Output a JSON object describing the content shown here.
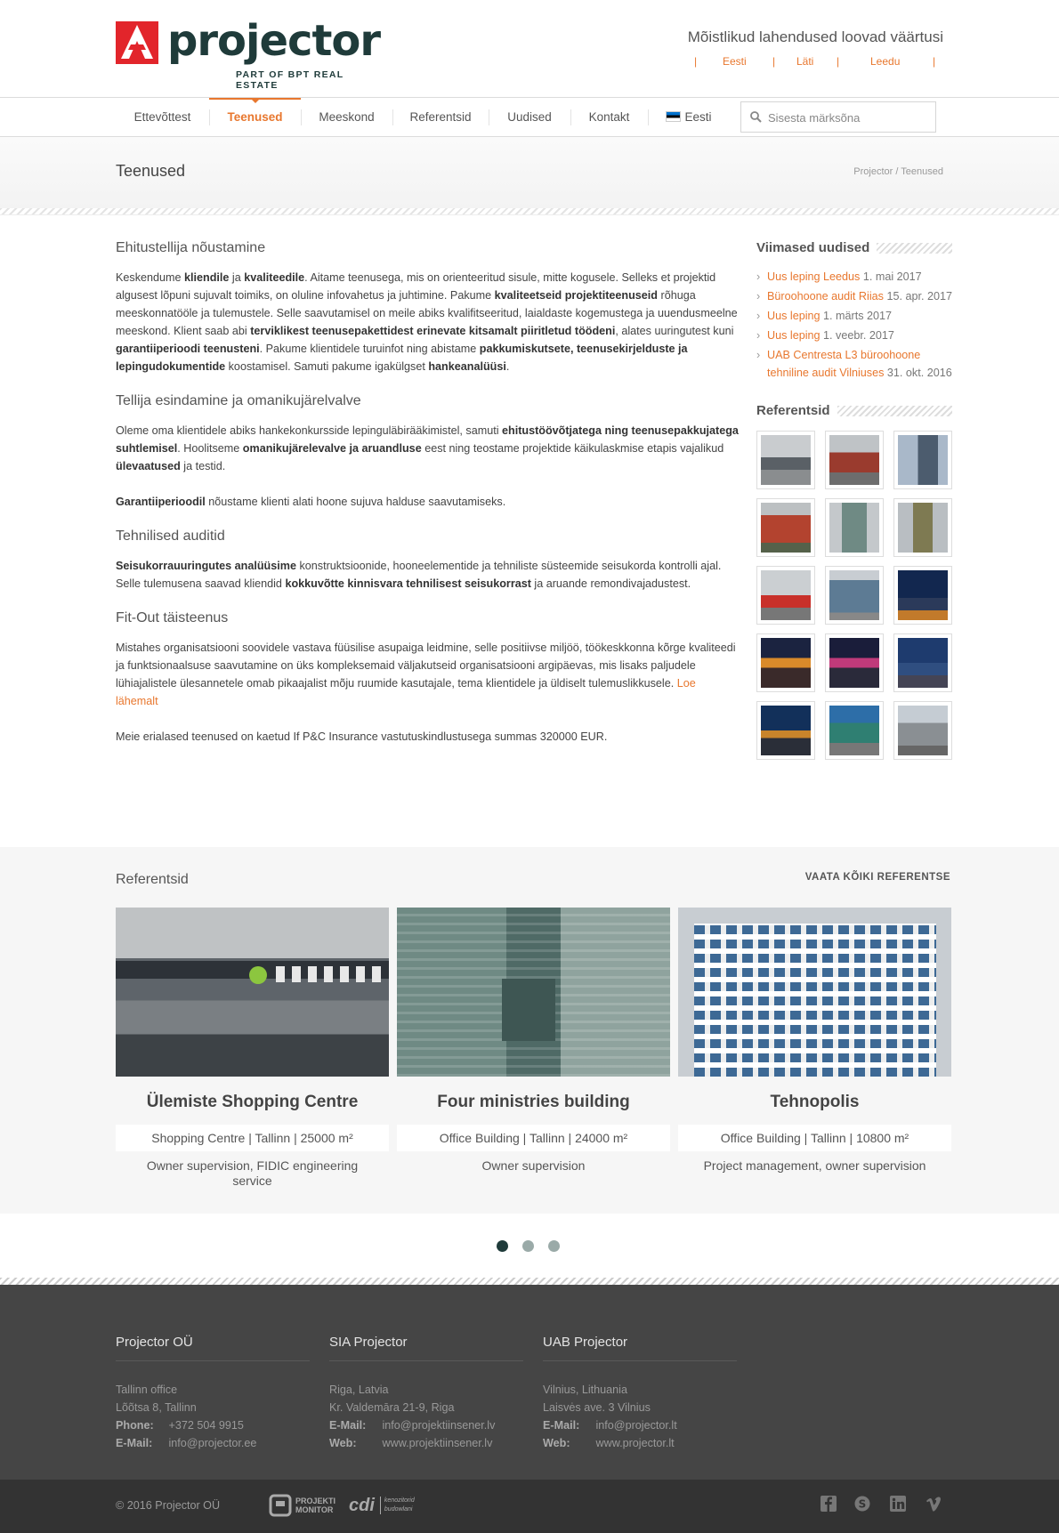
{
  "header": {
    "logo_text": "projector",
    "logo_sub": "PART OF BPT REAL ESTATE",
    "tagline": "Mõistlikud lahendused loovad väärtusi",
    "languages": [
      "Eesti",
      "Läti",
      "Leedu"
    ]
  },
  "nav": {
    "items": [
      "Ettevõttest",
      "Teenused",
      "Meeskond",
      "Referentsid",
      "Uudised",
      "Kontakt"
    ],
    "active": "Teenused",
    "lang_label": "Eesti",
    "search_placeholder": "Sisesta märksõna"
  },
  "titlebar": {
    "title": "Teenused",
    "breadcrumb": "Projector / Teenused"
  },
  "main": {
    "sec1_title": "Ehitustellija nõustamine",
    "sec2_title": "Tellija esindamine ja omanikujärelvalve",
    "sec3_title": "Tehnilised auditid",
    "sec4_title": "Fit-Out täisteenus",
    "read_more": "Loe lähemalt",
    "insurance": "Meie erialased teenused on kaetud If P&C Insurance vastutuskindlustusega summas 320000 EUR."
  },
  "sidebar": {
    "news_title": "Viimased uudised",
    "news": [
      {
        "link": "Uus leping Leedus",
        "date": "1. mai 2017"
      },
      {
        "link": "Büroohoone audit Riias",
        "date": "15. apr. 2017"
      },
      {
        "link": "Uus leping",
        "date": "1. märts 2017"
      },
      {
        "link": "Uus leping",
        "date": "1. veebr. 2017"
      },
      {
        "link": "UAB Centresta L3 büroohoone tehniline audit Vilniuses",
        "date": "31. okt. 2016"
      }
    ],
    "refs_title": "Referentsid"
  },
  "references": {
    "title": "Referentsid",
    "view_all": "VAATA KÕIKI REFERENTSE",
    "cards": [
      {
        "name": "Ülemiste Shopping Centre",
        "meta": "Shopping Centre | Tallinn | 25000 m²",
        "desc": "Owner supervision, FIDIC engineering service"
      },
      {
        "name": "Four ministries building",
        "meta": "Office Building | Tallinn | 24000 m²",
        "desc": "Owner supervision"
      },
      {
        "name": "Tehnopolis",
        "meta": "Office Building | Tallinn | 10800 m²",
        "desc": "Project management, owner supervision"
      }
    ],
    "slide_count": 3,
    "active_slide": 1
  },
  "footer": {
    "cols": [
      {
        "title": "Projector OÜ",
        "line1": "Tallinn office",
        "line2": "Lõõtsa 8, Tallinn",
        "k1": "Phone:",
        "v1": "+372 504 9915",
        "k2": "E-Mail:",
        "v2": "info@projector.ee"
      },
      {
        "title": "SIA Projector",
        "line1": "Riga, Latvia",
        "line2": "Kr. Valdemāra 21-9, Riga",
        "k1": "E-Mail:",
        "v1": "info@projektiinsener.lv",
        "k2": "Web:",
        "v2": "www.projektiinsener.lv"
      },
      {
        "title": "UAB Projector",
        "line1": "Vilnius, Lithuania",
        "line2": "Laisvės ave. 3 Vilnius",
        "k1": "E-Mail:",
        "v1": "info@projector.lt",
        "k2": "Web:",
        "v2": "www.projector.lt"
      }
    ],
    "copyright": "© 2016 Projector OÜ",
    "partner1": "PROJEKTI MONITOR",
    "partner2_mark": "cdi",
    "partner2_text": "kenozitorid budowlani",
    "social": [
      "facebook-icon",
      "skype-icon",
      "linkedin-icon",
      "vimeo-icon"
    ]
  },
  "colors": {
    "accent": "#e8772e",
    "brand": "#1f3b3a",
    "footer": "#454545",
    "footer_bottom": "#333333"
  }
}
